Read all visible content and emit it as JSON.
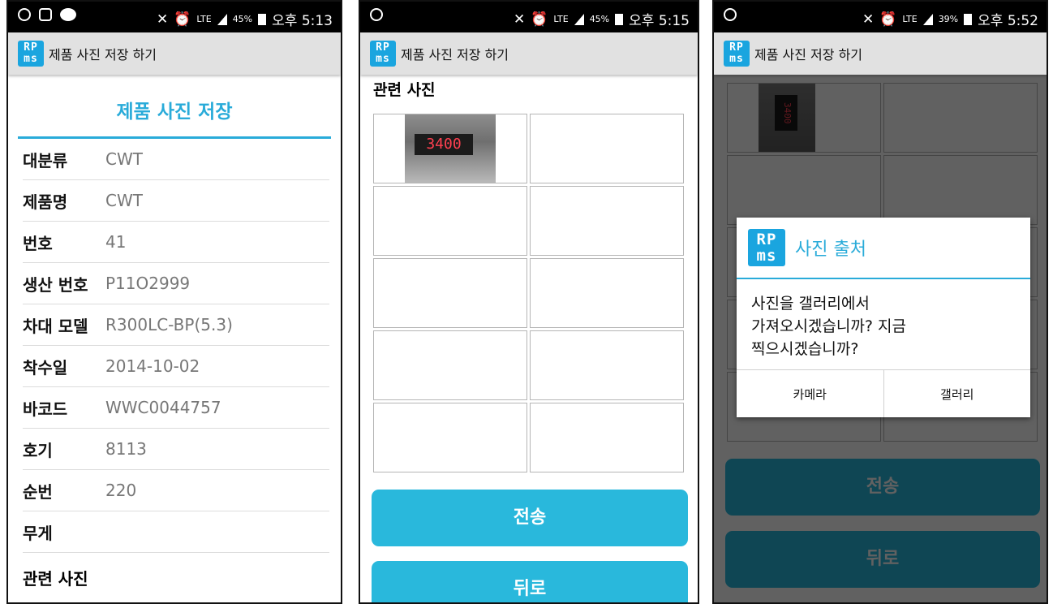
{
  "status": {
    "p1": {
      "battery": "45%",
      "time": "오후 5:13"
    },
    "p2": {
      "battery": "45%",
      "time": "오후 5:15"
    },
    "p3": {
      "battery": "39%",
      "time": "오후 5:52"
    },
    "network": "LTE",
    "talk_badge": "TALK"
  },
  "app": {
    "logo_text": "RP ms",
    "title": "제품 사진 저장 하기"
  },
  "form": {
    "title": "제품 사진 저장",
    "fields": [
      {
        "label": "대분류",
        "value": "CWT"
      },
      {
        "label": "제품명",
        "value": "CWT"
      },
      {
        "label": "번호",
        "value": "41"
      },
      {
        "label": "생산 번호",
        "value": "P11O2999"
      },
      {
        "label": "차대 모델",
        "value": "R300LC-BP(5.3)"
      },
      {
        "label": "착수일",
        "value": "2014-10-02"
      },
      {
        "label": "바코드",
        "value": "WWC0044757"
      },
      {
        "label": "호기",
        "value": "8113"
      },
      {
        "label": "순번",
        "value": "220"
      },
      {
        "label": "무게",
        "value": ""
      }
    ],
    "photos_label": "관련 사진"
  },
  "photos": {
    "display_reading": "3400",
    "display_reading_rotated": "3400"
  },
  "buttons": {
    "send": "전송",
    "back": "뒤로"
  },
  "dialog": {
    "title": "사진 출처",
    "message": "사진을 갤러리에서 가져오시겠습니까? 지금 찍으시겠습니까?",
    "message_lines": [
      "사진을 갤러리에서",
      "가져오시겠습니까? 지금",
      "찍으시겠습니까?"
    ],
    "camera": "카메라",
    "gallery": "갤러리"
  },
  "colors": {
    "accent": "#29abd9",
    "button": "#29b8dc",
    "appbar": "#e1e1e1"
  }
}
